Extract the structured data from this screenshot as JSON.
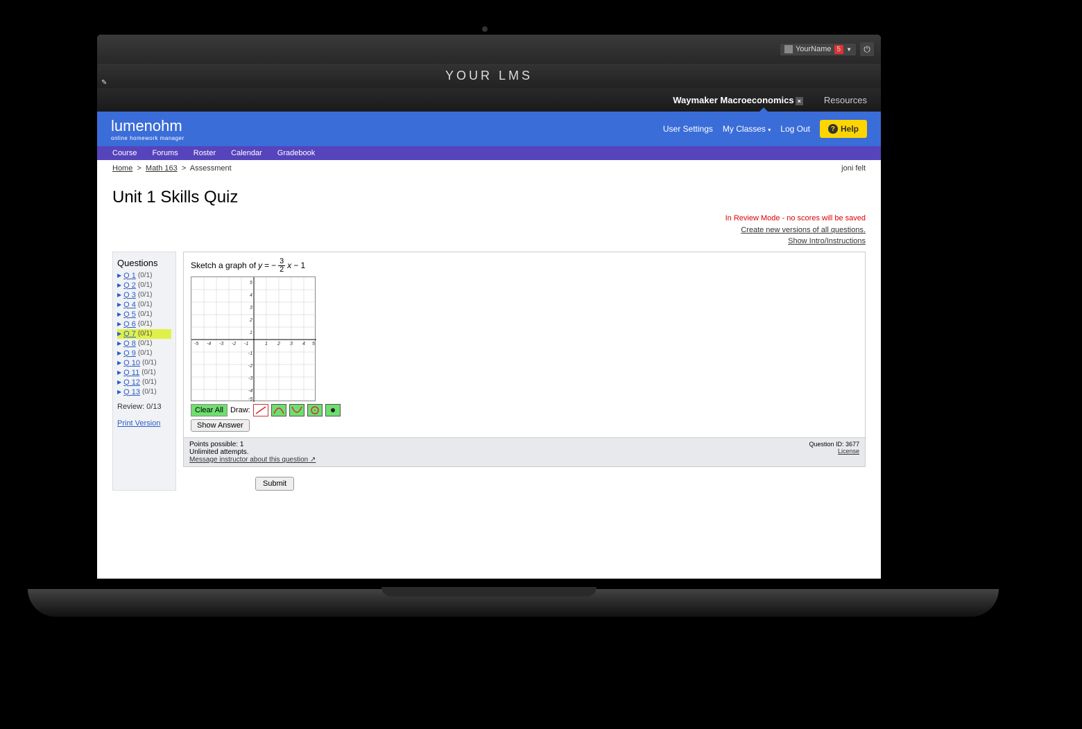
{
  "lms": {
    "title": "YOUR LMS",
    "user_name": "YourName",
    "notif_count": "5",
    "tabs": {
      "active": "Waymaker Macroeconomics",
      "resources": "Resources"
    }
  },
  "lumen": {
    "brand": "lumenohm",
    "tagline": "online homework manager",
    "links": {
      "user_settings": "User Settings",
      "my_classes": "My Classes",
      "log_out": "Log Out",
      "help": "Help"
    }
  },
  "nav": {
    "course": "Course",
    "forums": "Forums",
    "roster": "Roster",
    "calendar": "Calendar",
    "gradebook": "Gradebook"
  },
  "breadcrumb": {
    "home": "Home",
    "course": "Math 163",
    "current": "Assessment",
    "user": "joni felt"
  },
  "page": {
    "title": "Unit 1 Skills Quiz",
    "review_warn": "In Review Mode - no scores will be saved",
    "new_versions": "Create new versions of all questions.",
    "show_intro": "Show Intro/Instructions"
  },
  "sidebar": {
    "heading": "Questions",
    "items": [
      {
        "label": "Q 1",
        "score": "(0/1)"
      },
      {
        "label": "Q 2",
        "score": "(0/1)"
      },
      {
        "label": "Q 3",
        "score": "(0/1)"
      },
      {
        "label": "Q 4",
        "score": "(0/1)"
      },
      {
        "label": "Q 5",
        "score": "(0/1)"
      },
      {
        "label": "Q 6",
        "score": "(0/1)"
      },
      {
        "label": "Q 7",
        "score": "(0/1)"
      },
      {
        "label": "Q 8",
        "score": "(0/1)"
      },
      {
        "label": "Q 9",
        "score": "(0/1)"
      },
      {
        "label": "Q 10",
        "score": "(0/1)"
      },
      {
        "label": "Q 11",
        "score": "(0/1)"
      },
      {
        "label": "Q 12",
        "score": "(0/1)"
      },
      {
        "label": "Q 13",
        "score": "(0/1)"
      }
    ],
    "active_index": 6,
    "review": "Review: 0/13",
    "print": "Print Version"
  },
  "question": {
    "prompt_prefix": "Sketch a graph of ",
    "var_y": "y",
    "eq": " = ",
    "neg": "−",
    "num": "3",
    "den": "2",
    "var_x": "x",
    "tail": " − 1",
    "axis": {
      "xmin": -5,
      "xmax": 5,
      "ymin": -5,
      "ymax": 5
    },
    "clear": "Clear All",
    "draw_label": "Draw:",
    "show_answer": "Show Answer",
    "footer": {
      "points": "Points possible: 1",
      "attempts": "Unlimited attempts.",
      "message_link": "Message instructor about this question",
      "qid": "Question ID: 3677",
      "license": "License"
    }
  },
  "submit": "Submit"
}
